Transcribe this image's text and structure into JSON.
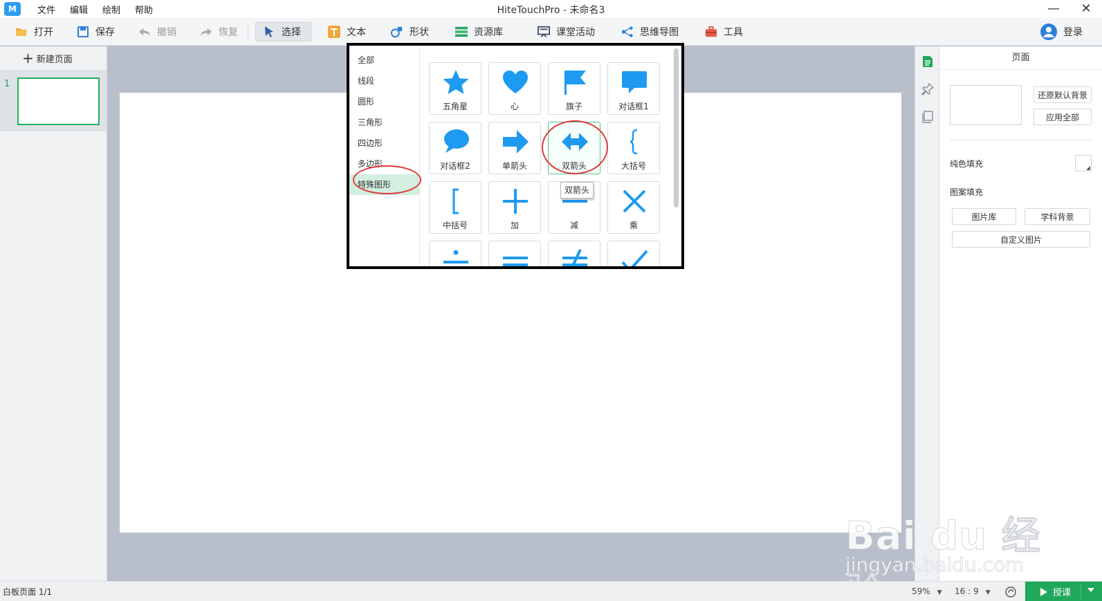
{
  "titlebar": {
    "logo": "M",
    "title": "HiteTouchPro - 未命名3",
    "menu": [
      "文件",
      "编辑",
      "绘制",
      "帮助"
    ],
    "minimize": "—",
    "close": "✕"
  },
  "toolbar": {
    "open": "打开",
    "save": "保存",
    "undo": "撤销",
    "redo": "恢复",
    "select": "选择",
    "text": "文本",
    "shape": "形状",
    "resources": "资源库",
    "classroom": "课堂活动",
    "mindmap": "思维导图",
    "tools": "工具",
    "login": "登录"
  },
  "left_panel": {
    "new_page": "新建页面",
    "plus": "+",
    "thumb_number": "1"
  },
  "shape_popup": {
    "categories": [
      "全部",
      "线段",
      "圆形",
      "三角形",
      "四边形",
      "多边形",
      "特殊图形"
    ],
    "active_category": "特殊图形",
    "shapes": [
      "五角星",
      "心",
      "旗子",
      "对话框1",
      "对话框2",
      "单箭头",
      "双箭头",
      "大括号",
      "中括号",
      "加",
      "减",
      "乘"
    ],
    "hovered_shape": "双箭头",
    "tooltip": "双箭头"
  },
  "right_panel": {
    "title": "页面",
    "restore_bg": "还原默认背景",
    "apply_all": "应用全部",
    "solid_fill": "纯色填充",
    "pattern_fill": "图案填充",
    "gallery": "图片库",
    "subject_bg": "学科背景",
    "custom_image": "自定义图片"
  },
  "statusbar": {
    "page_info": "白板页面 1/1",
    "zoom": "59%",
    "ratio": "16 : 9",
    "present": "授课"
  },
  "watermark": {
    "brand": "Bai du 经验",
    "url": "jingyan.baidu.com"
  },
  "colors": {
    "accent_green": "#1fa75a",
    "shape_blue": "#1e9af0",
    "annotation_red": "#e03a3a"
  }
}
